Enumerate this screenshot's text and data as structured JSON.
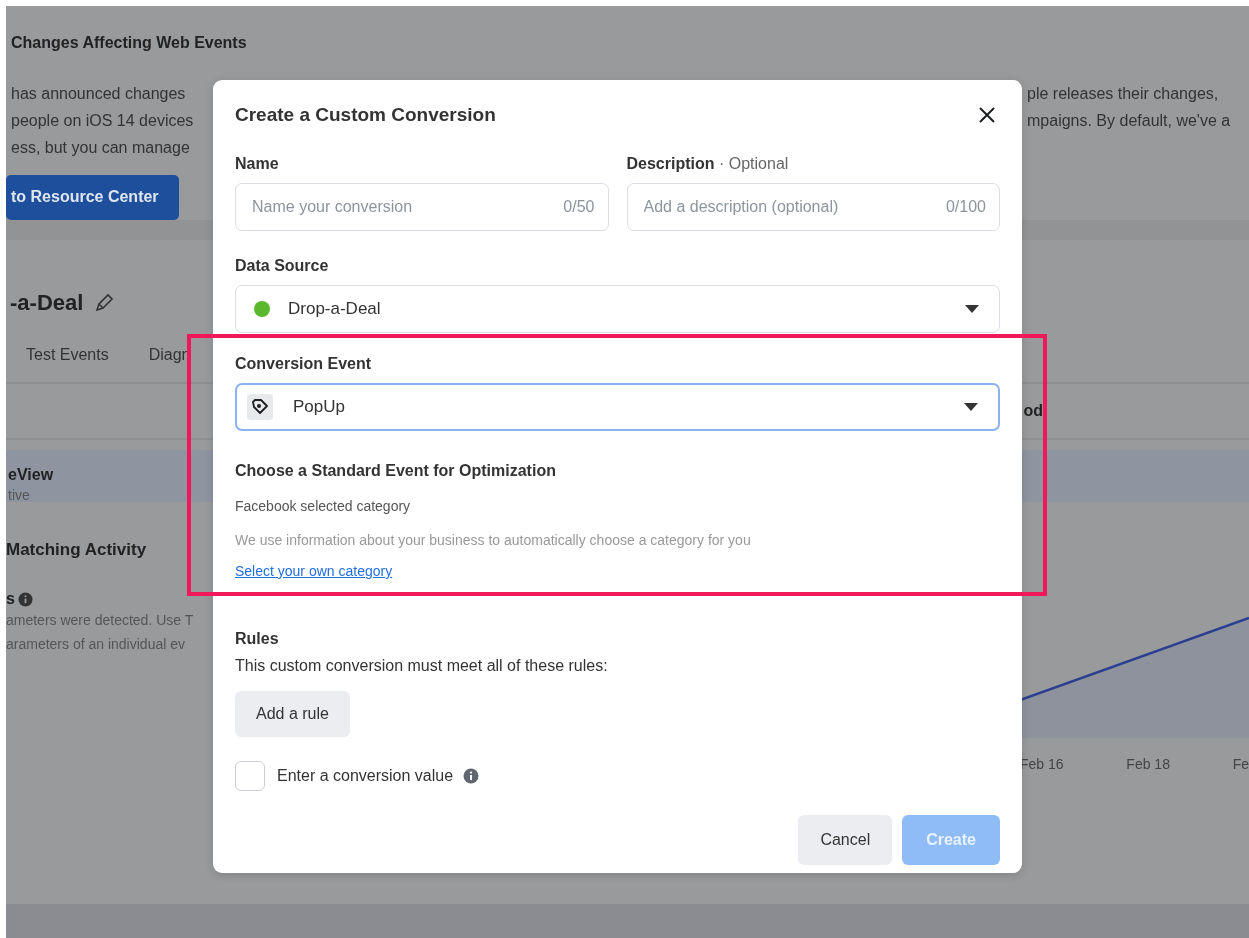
{
  "background": {
    "banner_title": "Changes Affecting Web Events",
    "banner_left_lines": [
      "has announced changes",
      "people on iOS 14 devices",
      "ess, but you can manage"
    ],
    "banner_right_lines": [
      "ple releases their changes,",
      "mpaigns. By default, we've a"
    ],
    "banner_button": "to Resource Center",
    "source_title": "-a-Deal",
    "tabs": [
      {
        "label": "Test Events",
        "selected": false
      },
      {
        "label": "Diagn",
        "selected": false
      }
    ],
    "column_header": "od",
    "event_row": {
      "name": "eView",
      "status": "tive"
    },
    "matching_title": "Matching Activity",
    "params_title": "s",
    "params_lines": [
      "ameters were detected. Use T",
      "arameters of an individual ev"
    ],
    "chart_labels": [
      "Feb 16",
      "Feb 18",
      "Fe"
    ]
  },
  "dialog": {
    "title": "Create a Custom Conversion",
    "name": {
      "label": "Name",
      "placeholder": "Name your conversion",
      "counter": "0/50"
    },
    "description": {
      "label": "**Description** · Optional",
      "placeholder": "Add a description (optional)",
      "counter": "0/100"
    },
    "data_source": {
      "label": "Data Source",
      "value": "Drop-a-Deal",
      "color": "#5bb82c"
    },
    "conversion_event": {
      "label": "Conversion Event",
      "value": "PopUp",
      "focused": true
    },
    "standard_event": {
      "title": "Choose a Standard Event for Optimization",
      "subtitle": "Facebook selected category",
      "hint": "We use information about your business to automatically choose a category for you",
      "link": "Select your own category"
    },
    "rules": {
      "title": "Rules",
      "text": "This custom conversion must meet all of these rules:",
      "button": "Add a rule"
    },
    "value_checkbox": {
      "label": "Enter a conversion value",
      "checked": false
    },
    "buttons": [
      {
        "label": "Cancel",
        "kind": "secondary",
        "disabled": false
      },
      {
        "label": "Create",
        "kind": "primary",
        "disabled": true
      }
    ]
  },
  "highlight": {
    "shown": true
  }
}
